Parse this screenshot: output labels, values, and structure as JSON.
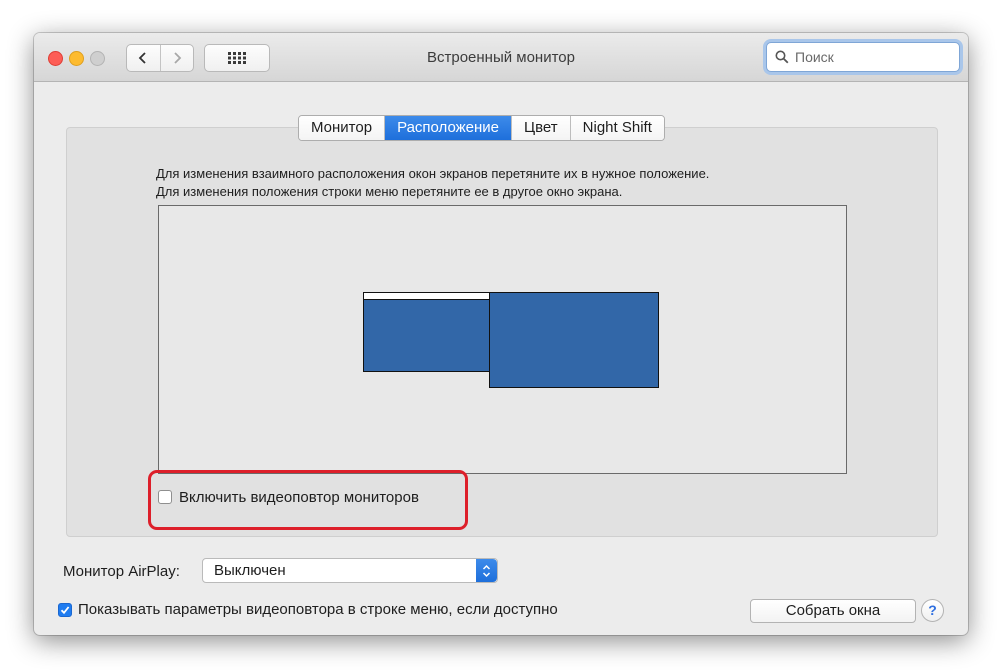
{
  "window": {
    "title": "Встроенный монитор"
  },
  "search": {
    "placeholder": "Поиск"
  },
  "tabs": [
    {
      "label": "Монитор",
      "active": false
    },
    {
      "label": "Расположение",
      "active": true
    },
    {
      "label": "Цвет",
      "active": false
    },
    {
      "label": "Night Shift",
      "active": false
    }
  ],
  "instructions": {
    "line1": "Для изменения взаимного расположения окон экранов перетяните их в нужное положение.",
    "line2": "Для изменения положения строки меню перетяните ее в другое окно экрана."
  },
  "mirror": {
    "label": "Включить видеоповтор мониторов",
    "checked": false
  },
  "airplay": {
    "label": "Монитор AirPlay:",
    "value": "Выключен"
  },
  "show_options": {
    "label": "Показывать параметры видеоповтора в строке меню, если доступно",
    "checked": true
  },
  "buttons": {
    "gather": "Собрать окна",
    "help": "?"
  },
  "colors": {
    "accent": "#1f6fdb",
    "display_fill": "#3267a8",
    "highlight_frame": "#dd1f2a"
  },
  "icons": {
    "back": "chevron-left-icon",
    "forward": "chevron-right-icon",
    "show_all": "grid-icon",
    "search": "magnifier-icon",
    "stepper": "up-down-chevron-icon"
  }
}
